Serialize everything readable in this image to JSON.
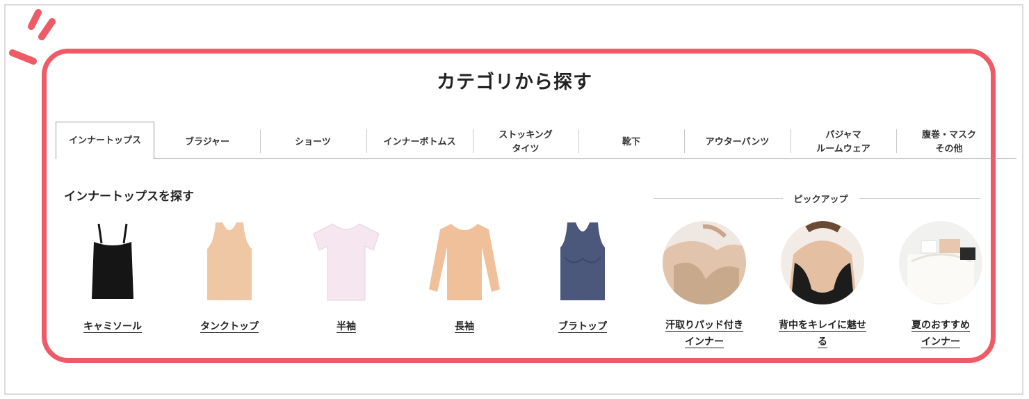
{
  "section_title": "カテゴリから探す",
  "tabs": [
    {
      "lines": [
        "インナートップス"
      ],
      "active": true
    },
    {
      "lines": [
        "ブラジャー"
      ]
    },
    {
      "lines": [
        "ショーツ"
      ]
    },
    {
      "lines": [
        "インナーボトムス"
      ]
    },
    {
      "lines": [
        "ストッキング",
        "タイツ"
      ]
    },
    {
      "lines": [
        "靴下"
      ]
    },
    {
      "lines": [
        "アウターパンツ"
      ]
    },
    {
      "lines": [
        "パジャマ",
        "ルームウェア"
      ]
    },
    {
      "lines": [
        "腹巻・マスク",
        "その他"
      ]
    }
  ],
  "subheading": "インナートップスを探す",
  "products": [
    {
      "label": "キャミソール",
      "icon": "camisole-image",
      "color": "#151515"
    },
    {
      "label": "タンクトップ",
      "icon": "tank-top-image",
      "color": "#f0c7a4"
    },
    {
      "label": "半袖",
      "icon": "short-sleeve-shirt-image",
      "color": "#f6e6ef"
    },
    {
      "label": "長袖",
      "icon": "long-sleeve-shirt-image",
      "color": "#f0c09b"
    },
    {
      "label": "ブラトップ",
      "icon": "bra-top-image",
      "color": "#4b587c"
    }
  ],
  "pickup": {
    "label": "ピックアップ",
    "items": [
      {
        "lines": [
          "汗取りパッド付き",
          "インナー"
        ],
        "icon": "sweat-pad-inner-photo"
      },
      {
        "lines": [
          "背中をキレイに魅せ",
          "る"
        ],
        "icon": "backless-inner-photo"
      },
      {
        "lines": [
          "夏のおすすめ",
          "インナー"
        ],
        "icon": "summer-inner-photo"
      }
    ]
  },
  "colors": {
    "accent": "#ef5a67"
  }
}
